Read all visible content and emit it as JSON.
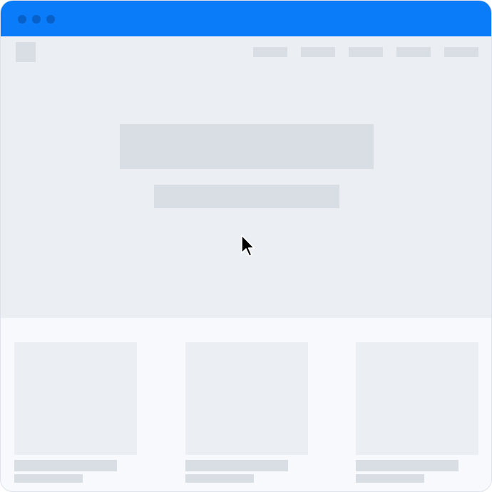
{
  "colors": {
    "titlebar": "#0a7bf9",
    "window_dot": "#0761c9",
    "hero_background": "#ebeef3",
    "content_background": "#f8f9fc",
    "placeholder_block": "#d8dee4",
    "card_image": "#ebeef3",
    "cursor": "#000000"
  },
  "icons": {
    "cursor": "arrow-cursor-icon",
    "logo": "logo-placeholder"
  },
  "nav": {
    "item_count": 5
  },
  "cards": {
    "count": 3
  }
}
